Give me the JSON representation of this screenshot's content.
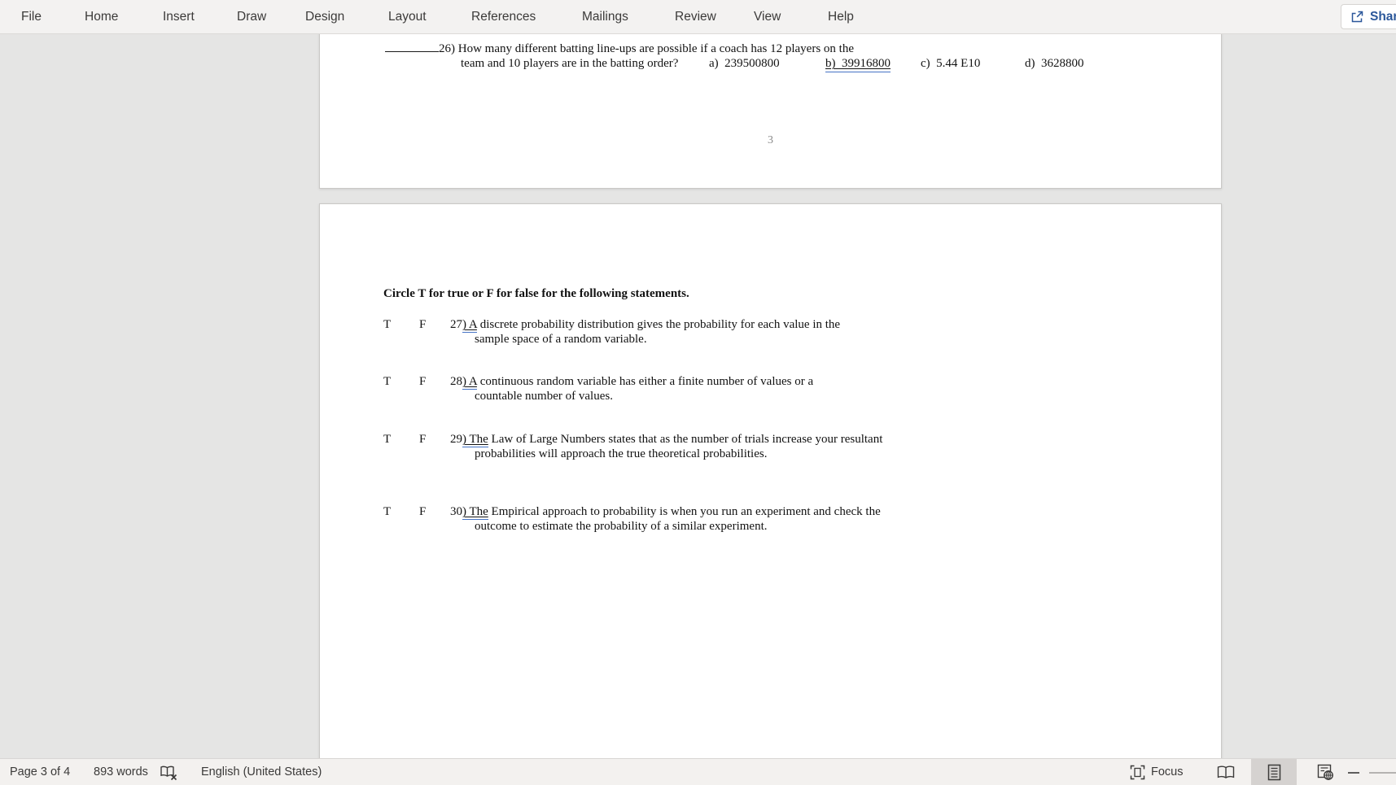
{
  "menu_bar": {
    "tabs": [
      "File",
      "Home",
      "Insert",
      "Draw",
      "Design",
      "Layout",
      "References",
      "Mailings",
      "Review",
      "View",
      "Help"
    ],
    "share_label": "Share"
  },
  "document": {
    "page3": {
      "q26_line1": "26) How many different batting line-ups are possible if a coach has 12 players on the",
      "q26_line2_lead": "team and 10 players are in the batting order?",
      "q26_options": {
        "a": "a)  239500800",
        "b": "b)  39916800",
        "c": "c)  5.44 E10",
        "d": "d)  3628800"
      },
      "footer_page_number": "3"
    },
    "page4": {
      "heading": "Circle T for true or F for false for the following statements.",
      "questions": [
        {
          "t": "T",
          "f": "F",
          "number": "27",
          "marked": ") A",
          "line1": " discrete probability distribution gives the probability for each value in the",
          "line2": "sample space of a random variable."
        },
        {
          "t": "T",
          "f": "F",
          "number": "28",
          "marked": ") A",
          "line1": " continuous random variable has either a finite number of values or a",
          "line2": "countable number of values."
        },
        {
          "t": "T",
          "f": "F",
          "number": "29",
          "marked": ") The",
          "line1": " Law of Large Numbers states that as the number of trials increase your resultant",
          "line2": "probabilities will approach the true theoretical probabilities."
        },
        {
          "t": "T",
          "f": "F",
          "number": "30",
          "marked": ") The",
          "line1": " Empirical approach to probability is when you run an experiment and check the",
          "line2": "outcome to estimate the probability of a similar experiment."
        }
      ]
    }
  },
  "status_bar": {
    "page_indicator": "Page 3 of 4",
    "word_count": "893 words",
    "language": "English (United States)",
    "focus_label": "Focus"
  },
  "colors": {
    "accent_blue": "#2b579a",
    "mark_underline_blue": "#4472c4",
    "canvas_background": "#e5e5e4",
    "page_background": "#ffffff"
  }
}
